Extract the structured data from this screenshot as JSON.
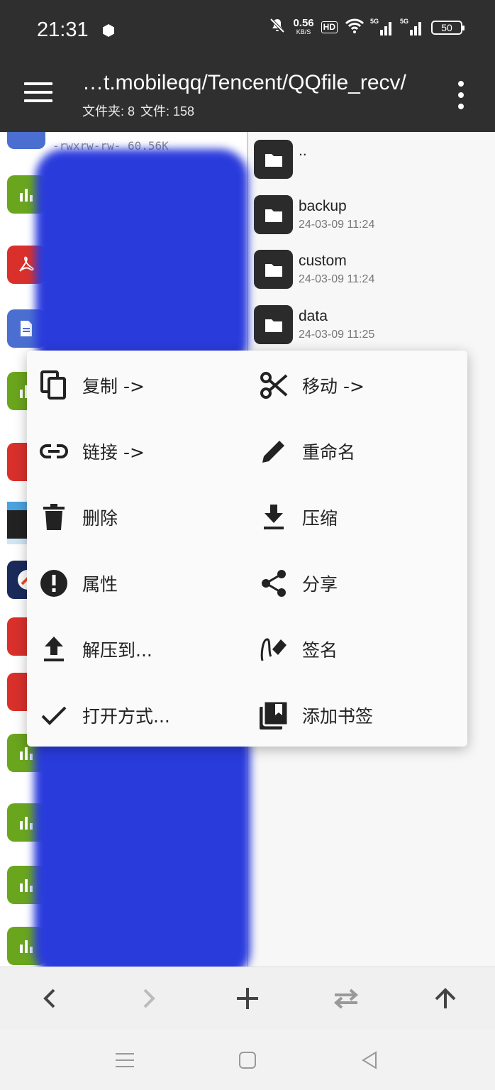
{
  "status": {
    "time": "21:31",
    "net_speed": "0.56",
    "net_unit": "KB/S",
    "hd": "HD",
    "signal1": "5G",
    "signal2": "5G",
    "battery": "50"
  },
  "appbar": {
    "path": "…t.mobileqq/Tencent/QQfile_recv/",
    "folders": "文件夹: 8",
    "files": "文件: 158"
  },
  "left_pane": {
    "partial_perm": "-rwxrw-rw-",
    "partial_size": "60.56K",
    "items": [
      {
        "icon": "chart-file-icon",
        "color": "#6aa51e"
      },
      {
        "icon": "pdf-file-icon",
        "color": "#d9302c"
      },
      {
        "icon": "document-file-icon",
        "color": "#4a6fd1"
      },
      {
        "icon": "chart-file-icon",
        "color": "#6aa51e"
      },
      {
        "icon": "pdf-file-icon",
        "color": "#d9302c"
      },
      {
        "icon": "image-thumbnail-icon",
        "color": "#333333"
      },
      {
        "icon": "app-icon",
        "color": "#1a2a5a"
      },
      {
        "icon": "pdf-file-icon",
        "color": "#d9302c"
      },
      {
        "icon": "pdf-file-icon",
        "color": "#d9302c"
      },
      {
        "icon": "chart-file-icon",
        "color": "#6aa51e"
      },
      {
        "icon": "chart-file-icon",
        "color": "#6aa51e"
      },
      {
        "icon": "chart-file-icon",
        "color": "#6aa51e"
      },
      {
        "icon": "chart-file-icon",
        "color": "#6aa51e"
      }
    ]
  },
  "right_pane": {
    "items": [
      {
        "name": "..",
        "date": ""
      },
      {
        "name": "backup",
        "date": "24-03-09 11:24"
      },
      {
        "name": "custom",
        "date": "24-03-09 11:24"
      },
      {
        "name": "data",
        "date": "24-03-09 11:25"
      }
    ]
  },
  "context_menu": {
    "copy": "复制 ->",
    "move": "移动 ->",
    "link": "链接 ->",
    "rename": "重命名",
    "delete": "删除",
    "compress": "压缩",
    "properties": "属性",
    "share": "分享",
    "extract": "解压到...",
    "sign": "签名",
    "open_with": "打开方式...",
    "bookmark": "添加书签"
  }
}
